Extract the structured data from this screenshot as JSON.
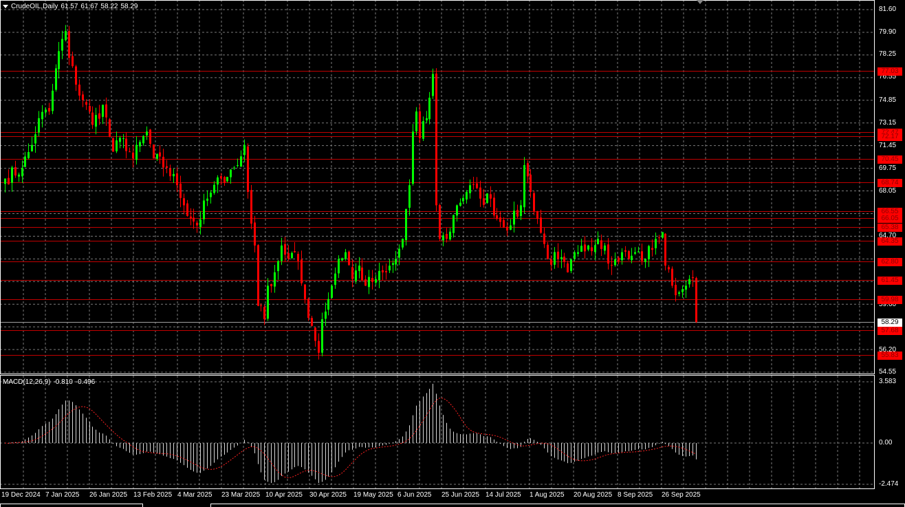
{
  "header": {
    "symbol": "CrudeOIL,Daily",
    "open": "61.57",
    "high": "61.67",
    "low": "58.22",
    "close": "58.29"
  },
  "macd": {
    "label": "MACD(12,26,9)",
    "main": "-0.810",
    "signal": "-0.496",
    "axis_labels": [
      "3.583",
      "0.00",
      "-2.474"
    ]
  },
  "colors": {
    "bull": "#00ff00",
    "bear": "#ff0000",
    "level_line": "#c00000",
    "grid": "#7a7a7a"
  },
  "chart_data": {
    "type": "candlestick",
    "symbol": "CrudeOIL",
    "timeframe": "Daily",
    "ylim": [
      54.55,
      81.6
    ],
    "price_axis_labels": [
      "81.60",
      "79.90",
      "78.25",
      "76.55",
      "74.85",
      "73.15",
      "71.45",
      "69.75",
      "68.05",
      "64.70",
      "59.60",
      "56.20",
      "54.55"
    ],
    "current_price": "58.29",
    "levels": [
      "77.03",
      "72.47",
      "72.17",
      "70.45",
      "68.74",
      "66.55",
      "66.05",
      "65.38",
      "64.35",
      "62.80",
      "61.45",
      "59.98",
      "57.68",
      "55.83"
    ],
    "date_labels": [
      "19 Dec 2024",
      "7 Jan 2025",
      "26 Jan 2025",
      "13 Feb 2025",
      "4 Mar 2025",
      "23 Mar 2025",
      "10 Apr 2025",
      "30 Apr 2025",
      "19 May 2025",
      "6 Jun 2025",
      "25 Jun 2025",
      "14 Jul 2025",
      "1 Aug 2025",
      "20 Aug 2025",
      "8 Sep 2025",
      "26 Sep 2025"
    ],
    "bar_count": 206,
    "close_waypoints": [
      [
        0,
        69.0
      ],
      [
        5,
        69.8
      ],
      [
        8,
        71.5
      ],
      [
        10,
        73.5
      ],
      [
        13,
        74.0
      ],
      [
        16,
        78.5
      ],
      [
        18,
        80.0
      ],
      [
        19,
        78.0
      ],
      [
        21,
        76.0
      ],
      [
        24,
        74.5
      ],
      [
        26,
        73.0
      ],
      [
        29,
        74.5
      ],
      [
        32,
        71.0
      ],
      [
        35,
        72.0
      ],
      [
        38,
        70.5
      ],
      [
        42,
        72.5
      ],
      [
        44,
        70.5
      ],
      [
        48,
        69.8
      ],
      [
        51,
        68.5
      ],
      [
        53,
        67.0
      ],
      [
        57,
        65.5
      ],
      [
        60,
        67.5
      ],
      [
        64,
        69.0
      ],
      [
        69,
        70.0
      ],
      [
        71,
        71.5
      ],
      [
        72,
        68.0
      ],
      [
        74,
        64.0
      ],
      [
        75,
        59.5
      ],
      [
        77,
        58.5
      ],
      [
        78,
        61.0
      ],
      [
        80,
        62.0
      ],
      [
        82,
        64.0
      ],
      [
        84,
        63.0
      ],
      [
        86,
        63.5
      ],
      [
        89,
        60.0
      ],
      [
        91,
        58.0
      ],
      [
        93,
        56.0
      ],
      [
        94,
        58.5
      ],
      [
        97,
        61.0
      ],
      [
        99,
        63.0
      ],
      [
        101,
        63.5
      ],
      [
        103,
        61.5
      ],
      [
        105,
        62.5
      ],
      [
        107,
        61.0
      ],
      [
        110,
        61.5
      ],
      [
        113,
        62.0
      ],
      [
        116,
        63.0
      ],
      [
        118,
        64.5
      ],
      [
        120,
        68.5
      ],
      [
        121,
        72.5
      ],
      [
        122,
        74.0
      ],
      [
        123,
        72.0
      ],
      [
        125,
        73.5
      ],
      [
        127,
        76.8
      ],
      [
        128,
        67.0
      ],
      [
        129,
        64.5
      ],
      [
        131,
        64.5
      ],
      [
        134,
        67.0
      ],
      [
        138,
        68.5
      ],
      [
        141,
        67.5
      ],
      [
        144,
        67.5
      ],
      [
        146,
        66.0
      ],
      [
        150,
        65.5
      ],
      [
        153,
        67.0
      ],
      [
        154,
        70.0
      ],
      [
        156,
        68.0
      ],
      [
        158,
        66.0
      ],
      [
        161,
        63.0
      ],
      [
        164,
        63.0
      ],
      [
        167,
        62.0
      ],
      [
        170,
        63.5
      ],
      [
        173,
        64.0
      ],
      [
        176,
        64.5
      ],
      [
        178,
        64.0
      ],
      [
        180,
        62.5
      ],
      [
        183,
        63.5
      ],
      [
        185,
        63.0
      ],
      [
        187,
        63.5
      ],
      [
        190,
        63.0
      ],
      [
        193,
        64.5
      ],
      [
        195,
        65.0
      ],
      [
        196,
        62.5
      ],
      [
        198,
        61.0
      ],
      [
        200,
        60.5
      ],
      [
        202,
        61.0
      ],
      [
        203,
        61.5
      ],
      [
        204,
        61.57
      ],
      [
        205,
        58.29
      ]
    ]
  }
}
